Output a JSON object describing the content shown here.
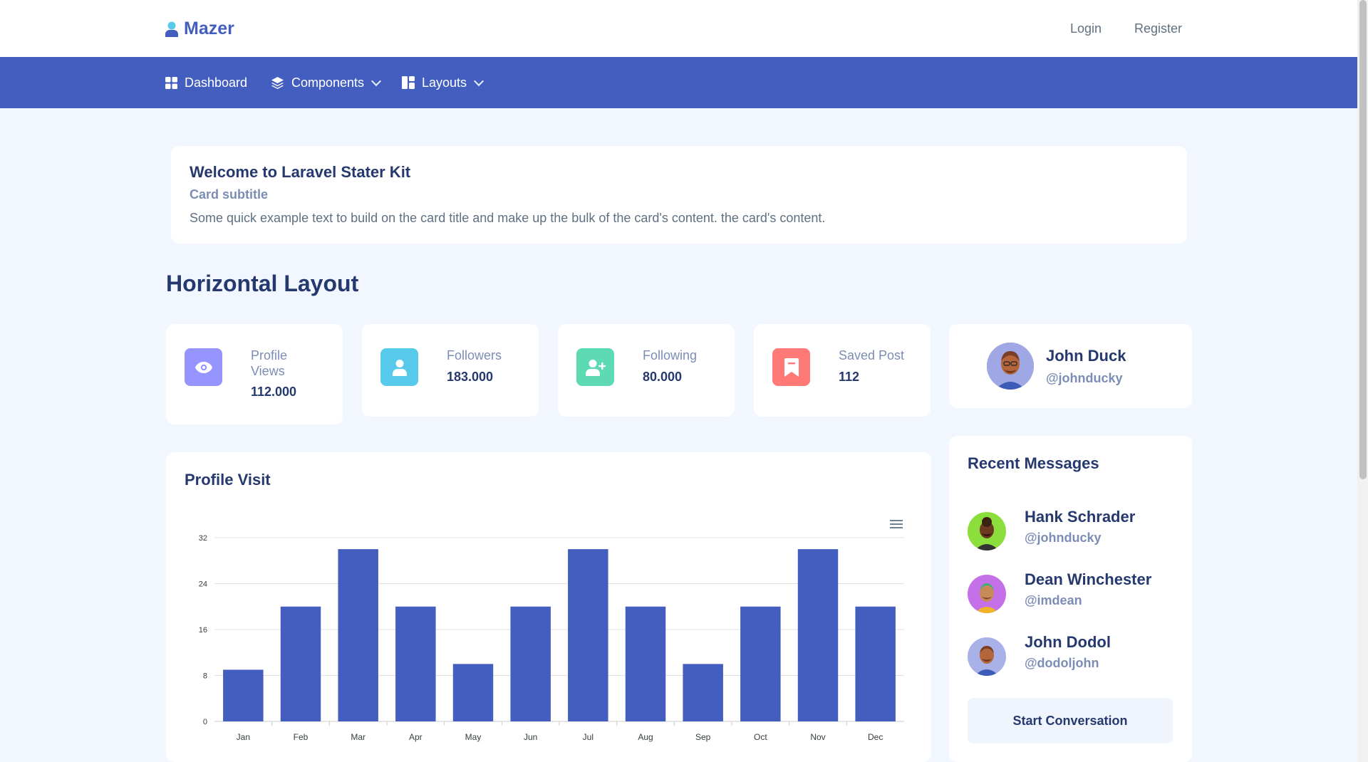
{
  "header": {
    "brand": "Mazer",
    "login_label": "Login",
    "register_label": "Register"
  },
  "nav": {
    "items": [
      {
        "label": "Dashboard",
        "icon": "grid-icon"
      },
      {
        "label": "Components",
        "icon": "stack-icon"
      },
      {
        "label": "Layouts",
        "icon": "layout-icon"
      }
    ]
  },
  "welcome": {
    "title": "Welcome to Laravel Stater Kit",
    "subtitle": "Card subtitle",
    "text": "Some quick example text to build on the card title and make up the bulk of the card's content. the card's content."
  },
  "page_title": "Horizontal Layout",
  "stats": [
    {
      "label_line1": "Profile",
      "label_line2": "Views",
      "value": "112.000",
      "icon": "eye-icon",
      "color": "#9694ff"
    },
    {
      "label_line1": "Followers",
      "label_line2": "",
      "value": "183.000",
      "icon": "person-icon",
      "color": "#57caeb"
    },
    {
      "label_line1": "Following",
      "label_line2": "",
      "value": "80.000",
      "icon": "person-plus-icon",
      "color": "#5ddab4"
    },
    {
      "label_line1": "Saved Post",
      "label_line2": "",
      "value": "112",
      "icon": "bookmark-icon",
      "color": "#ff7976"
    }
  ],
  "profile": {
    "name": "John Duck",
    "handle": "@johnducky"
  },
  "chart_card": {
    "title": "Profile Visit"
  },
  "chart_data": {
    "type": "bar",
    "categories": [
      "Jan",
      "Feb",
      "Mar",
      "Apr",
      "May",
      "Jun",
      "Jul",
      "Aug",
      "Sep",
      "Oct",
      "Nov",
      "Dec"
    ],
    "values": [
      9,
      20,
      30,
      20,
      10,
      20,
      30,
      20,
      10,
      20,
      30,
      20
    ],
    "ylim": [
      0,
      32
    ],
    "yticks": [
      0,
      8,
      16,
      24,
      32
    ],
    "bar_color": "#435ebe",
    "grid": true,
    "legend": "none"
  },
  "messages": {
    "title": "Recent Messages",
    "items": [
      {
        "name": "Hank Schrader",
        "handle": "@johnducky",
        "avatar_color": "#8bde3c"
      },
      {
        "name": "Dean Winchester",
        "handle": "@imdean",
        "avatar_color": "#c470e8"
      },
      {
        "name": "John Dodol",
        "handle": "@dodoljohn",
        "avatar_color": "#a8b1e8"
      }
    ],
    "button_label": "Start Conversation"
  },
  "colors": {
    "primary": "#435ebe",
    "background": "#f2f7ff",
    "heading": "#25396f",
    "muted": "#7c8db5"
  }
}
